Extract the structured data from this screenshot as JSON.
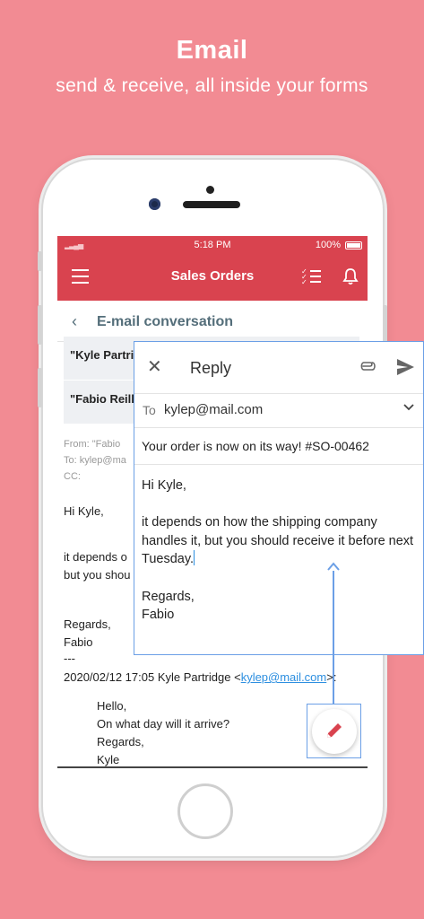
{
  "hero": {
    "title": "Email",
    "subtitle": "send & receive, all inside your forms"
  },
  "status_bar": {
    "time": "5:18 PM",
    "battery": "100%"
  },
  "app_bar": {
    "title": "Sales Orders",
    "icons": [
      "menu-icon",
      "checklist-icon",
      "bell-icon"
    ]
  },
  "conversation": {
    "title": "E-mail conversation",
    "recipients": [
      "\"Kyle Partrid",
      "\"Fabio Reilly"
    ],
    "meta": [
      "From: \"Fabio",
      "To: kylep@ma",
      "CC:"
    ],
    "greeting": "Hi Kyle,",
    "body_lines": [
      "it depends o",
      "but you shou"
    ],
    "signoff": [
      "Regards,",
      "Fabio"
    ],
    "separator": "---",
    "quote_header_prefix": "2020/02/12 17:05 Kyle Partridge <",
    "quote_header_email": "kylep@mail.com",
    "quote_header_suffix": ">:",
    "quoted_lines": [
      "Hello,",
      "On what day will it arrive?",
      "Regards,",
      "Kyle"
    ]
  },
  "reply": {
    "title": "Reply",
    "to_label": "To",
    "to_value": "kylep@mail.com",
    "subject": "Your order is now on its way! #SO-00462",
    "body": "Hi Kyle,\n\nit depends on how the shipping company handles it, but you should receive it before next Tuesday.",
    "closing": "\n\nRegards,\nFabio"
  },
  "colors": {
    "background": "#f28b93",
    "app_bar": "#d9434f",
    "highlight": "#6b9fe6",
    "accent_icon": "#d9434f"
  }
}
